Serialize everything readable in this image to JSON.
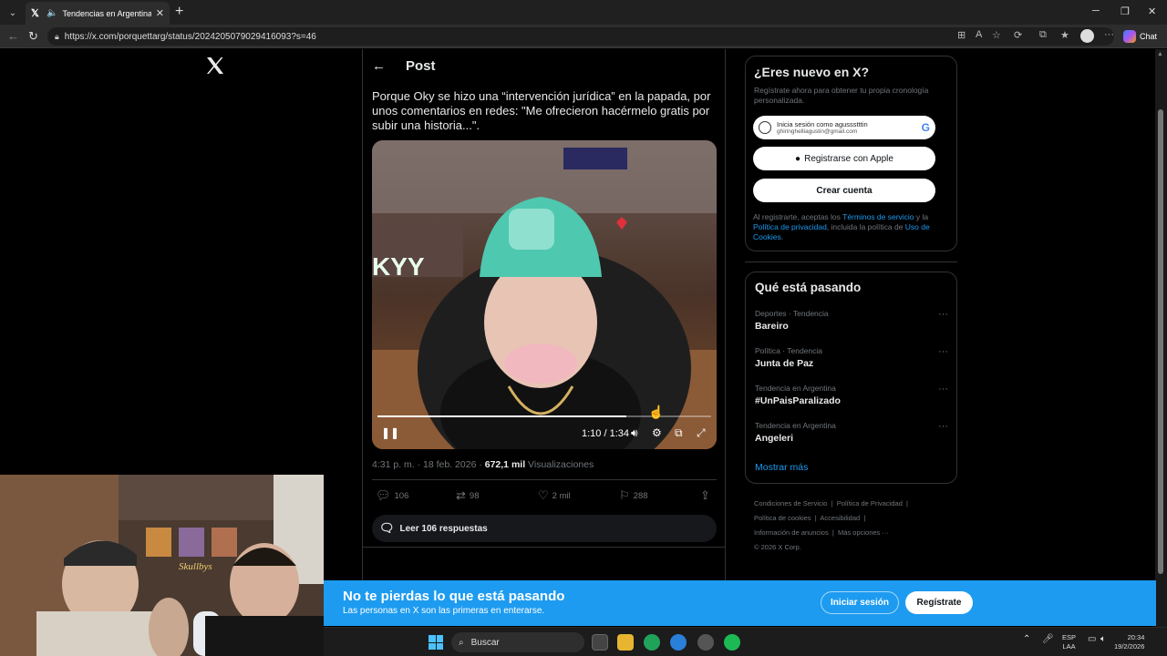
{
  "browser": {
    "tab_title": "Tendencias en Argentina en X",
    "url": "https://x.com/porquettarg/status/2024205079029416093?s=46",
    "chat_label": "Chat"
  },
  "post": {
    "header_title": "Post",
    "text": "Porque Oky se hizo una “intervención jurídica” en la papada, por unos comentarios en redes: \"Me ofrecieron hacérmelo gratis por subir una historia...\".",
    "video": {
      "time": "1:10 / 1:34",
      "progress_fraction": 0.745
    },
    "timestamp": "4:31 p. m. · 18 feb. 2026 · ",
    "views_count": "672,1 mil",
    "views_label": " Visualizaciones",
    "actions": {
      "replies": "106",
      "reposts": "98",
      "likes": "2 mil",
      "bookmarks": "288"
    },
    "read_replies": "Leer 106 respuestas"
  },
  "signup_card": {
    "title": "¿Eres nuevo en X?",
    "subtitle": "Regístrate ahora para obtener tu propia cronología personalizada.",
    "google_line1": "Inicia sesión como agussstttin",
    "google_line2": "ghiringhelliagustin@gmail.com",
    "apple_label": "Registrarse con Apple",
    "create_label": "Crear cuenta",
    "legal_prefix": "Al registrarte, aceptas los ",
    "legal_terms": "Términos de servicio",
    "legal_mid": " y la ",
    "legal_privacy": "Política de privacidad",
    "legal_mid2": ", incluida la política de ",
    "legal_cookies": "Uso de Cookies",
    "legal_end": "."
  },
  "trends": {
    "title": "Qué está pasando",
    "items": [
      {
        "category": "Deportes · Tendencia",
        "name": "Bareiro"
      },
      {
        "category": "Política · Tendencia",
        "name": "Junta de Paz"
      },
      {
        "category": "Tendencia en Argentina",
        "name": "#UnPaisParalizado"
      },
      {
        "category": "Tendencia en Argentina",
        "name": "Angeleri"
      }
    ],
    "show_more": "Mostrar más"
  },
  "footer": {
    "terms": "Condiciones de Servicio",
    "privacy": "Política de Privacidad",
    "cookies": "Política de cookies",
    "accessibility": "Accesibilidad",
    "ads": "Información de anuncios",
    "more": "Más opciones ···",
    "copyright": "© 2026 X Corp."
  },
  "banner": {
    "title": "No te pierdas lo que está pasando",
    "subtitle": "Las personas en X son las primeras en enterarse.",
    "login": "Iniciar sesión",
    "signup": "Regístrate"
  },
  "taskbar": {
    "search_label": "Buscar",
    "lang_top": "ESP",
    "lang_bottom": "LAA",
    "time": "20:34",
    "date": "19/2/2026"
  },
  "colors": {
    "accent": "#1d9bf0",
    "background": "#000000",
    "border": "#2f3336",
    "secondary_text": "#71767b"
  }
}
